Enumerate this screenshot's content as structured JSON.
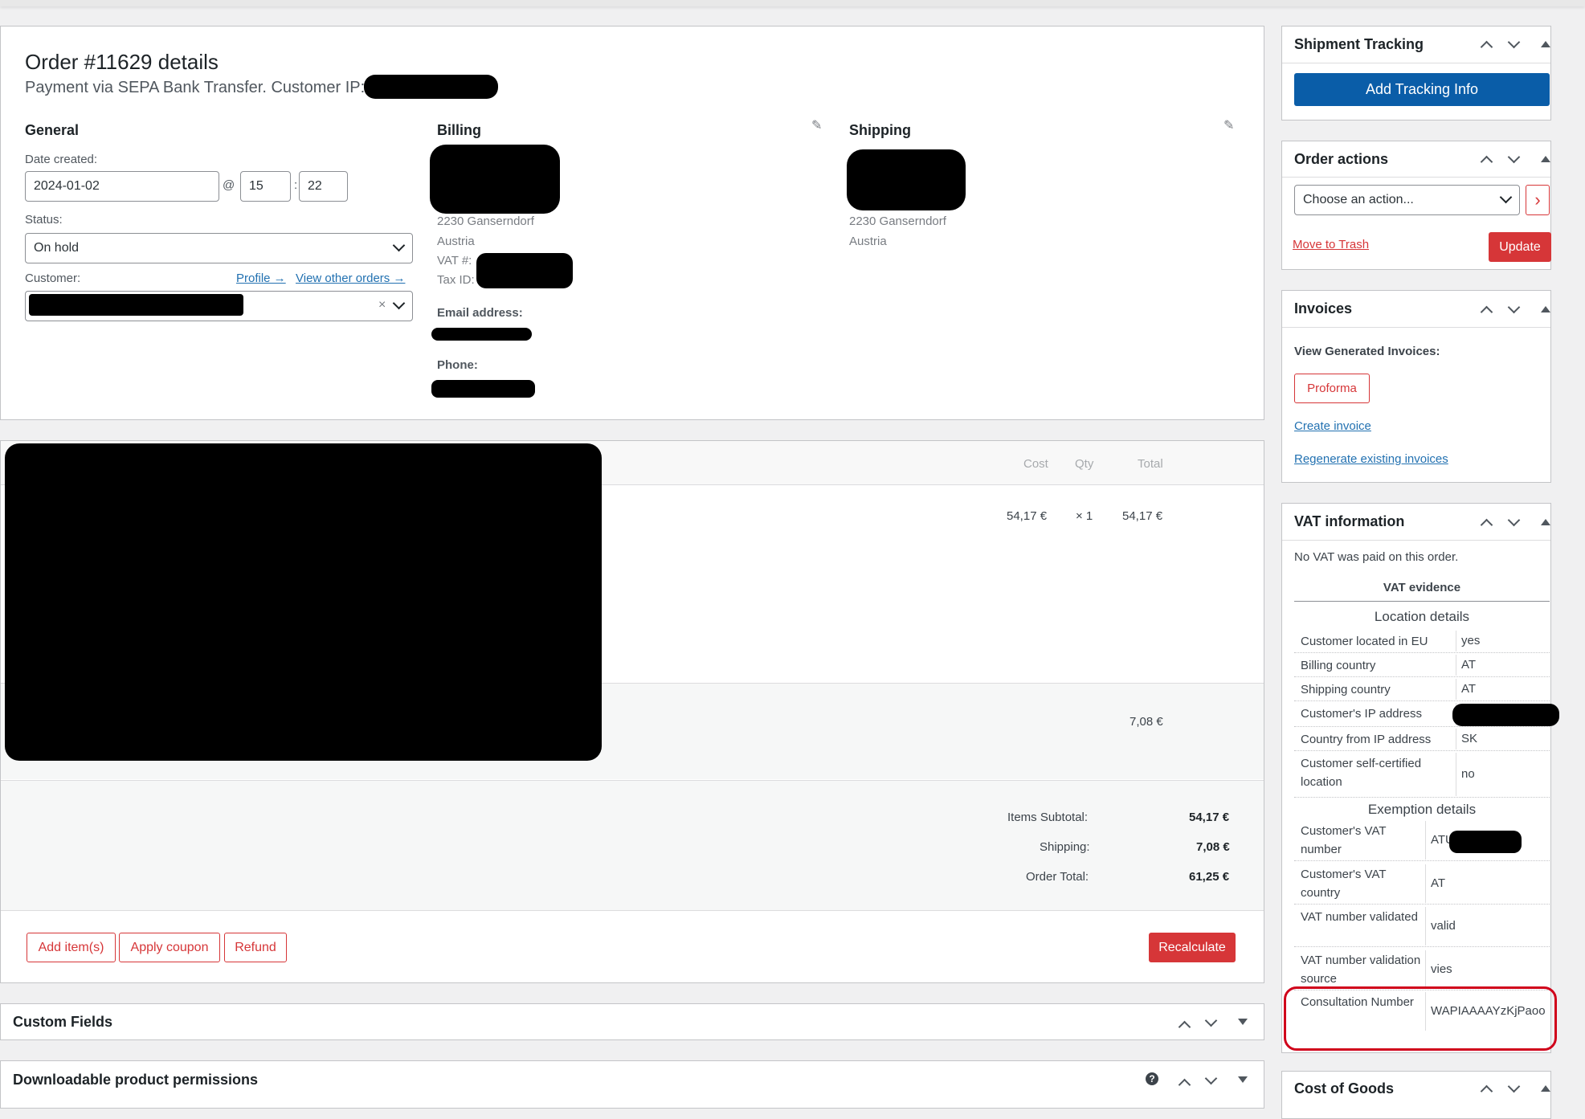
{
  "order": {
    "title": "Order #11629 details",
    "subtitle": "Payment via SEPA Bank Transfer. Customer IP:"
  },
  "general": {
    "heading": "General",
    "date_label": "Date created:",
    "date_value": "2024-01-02",
    "at_symbol": "@",
    "hour": "15",
    "colon": ":",
    "minute": "22",
    "status_label": "Status:",
    "status_value": "On hold",
    "customer_label": "Customer:",
    "profile_link": "Profile →",
    "other_orders_link": "View other orders →",
    "clear_symbol": "×"
  },
  "billing": {
    "heading": "Billing",
    "city": "2230 Ganserndorf",
    "country": "Austria",
    "vat_label": "VAT #:",
    "tax_label": "Tax ID:",
    "email_label": "Email address:",
    "phone_label": "Phone:"
  },
  "shipping": {
    "heading": "Shipping",
    "city": "2230 Ganserndorf",
    "country": "Austria"
  },
  "items": {
    "col_cost": "Cost",
    "col_qty": "Qty",
    "col_total": "Total",
    "line_cost": "54,17 €",
    "line_qty": "× 1",
    "line_total": "54,17 €",
    "shipping_total": "7,08 €"
  },
  "totals": {
    "subtotal_label": "Items Subtotal:",
    "subtotal_value": "54,17 €",
    "shipping_label": "Shipping:",
    "shipping_value": "7,08 €",
    "order_total_label": "Order Total:",
    "order_total_value": "61,25 €"
  },
  "actions": {
    "add_items": "Add item(s)",
    "apply_coupon": "Apply coupon",
    "refund": "Refund",
    "recalculate": "Recalculate"
  },
  "panels": {
    "custom_fields": "Custom Fields",
    "downloadable": "Downloadable product permissions",
    "help_symbol": "?"
  },
  "sidebar": {
    "shipment_tracking": {
      "title": "Shipment Tracking",
      "add_button": "Add Tracking Info"
    },
    "order_actions": {
      "title": "Order actions",
      "select_value": "Choose an action...",
      "go_symbol": "›",
      "trash_link": "Move to Trash",
      "update_button": "Update"
    },
    "invoices": {
      "title": "Invoices",
      "view_label": "View Generated Invoices:",
      "proforma_button": "Proforma",
      "create_link": "Create invoice",
      "regenerate_link": "Regenerate existing invoices"
    },
    "vat": {
      "title": "VAT information",
      "no_vat_text": "No VAT was paid on this order.",
      "evidence_heading": "VAT evidence",
      "location_heading": "Location details",
      "location_rows": [
        {
          "key": "Customer located in EU",
          "value": "yes"
        },
        {
          "key": "Billing country",
          "value": "AT"
        },
        {
          "key": "Shipping country",
          "value": "AT"
        },
        {
          "key": "Customer's IP address",
          "value": ""
        },
        {
          "key": "Country from IP address",
          "value": "SK"
        },
        {
          "key": "Customer self-certified location",
          "value": "no"
        }
      ],
      "exemption_heading": "Exemption details",
      "exemption_rows": [
        {
          "key": "Customer's VAT number",
          "value": "ATU"
        },
        {
          "key": "Customer's VAT country",
          "value": "AT"
        },
        {
          "key": "VAT number validated",
          "value": "valid"
        },
        {
          "key": "VAT number validation source",
          "value": "vies"
        },
        {
          "key": "Consultation Number",
          "value": "WAPIAAAAYzKjPaoo"
        }
      ],
      "highlight_color": "#d0021b"
    },
    "cost_of_goods": {
      "title": "Cost of Goods"
    }
  },
  "colors": {
    "accent_red": "#d63638",
    "primary_blue": "#0a5da8",
    "link_blue": "#2271b1"
  }
}
